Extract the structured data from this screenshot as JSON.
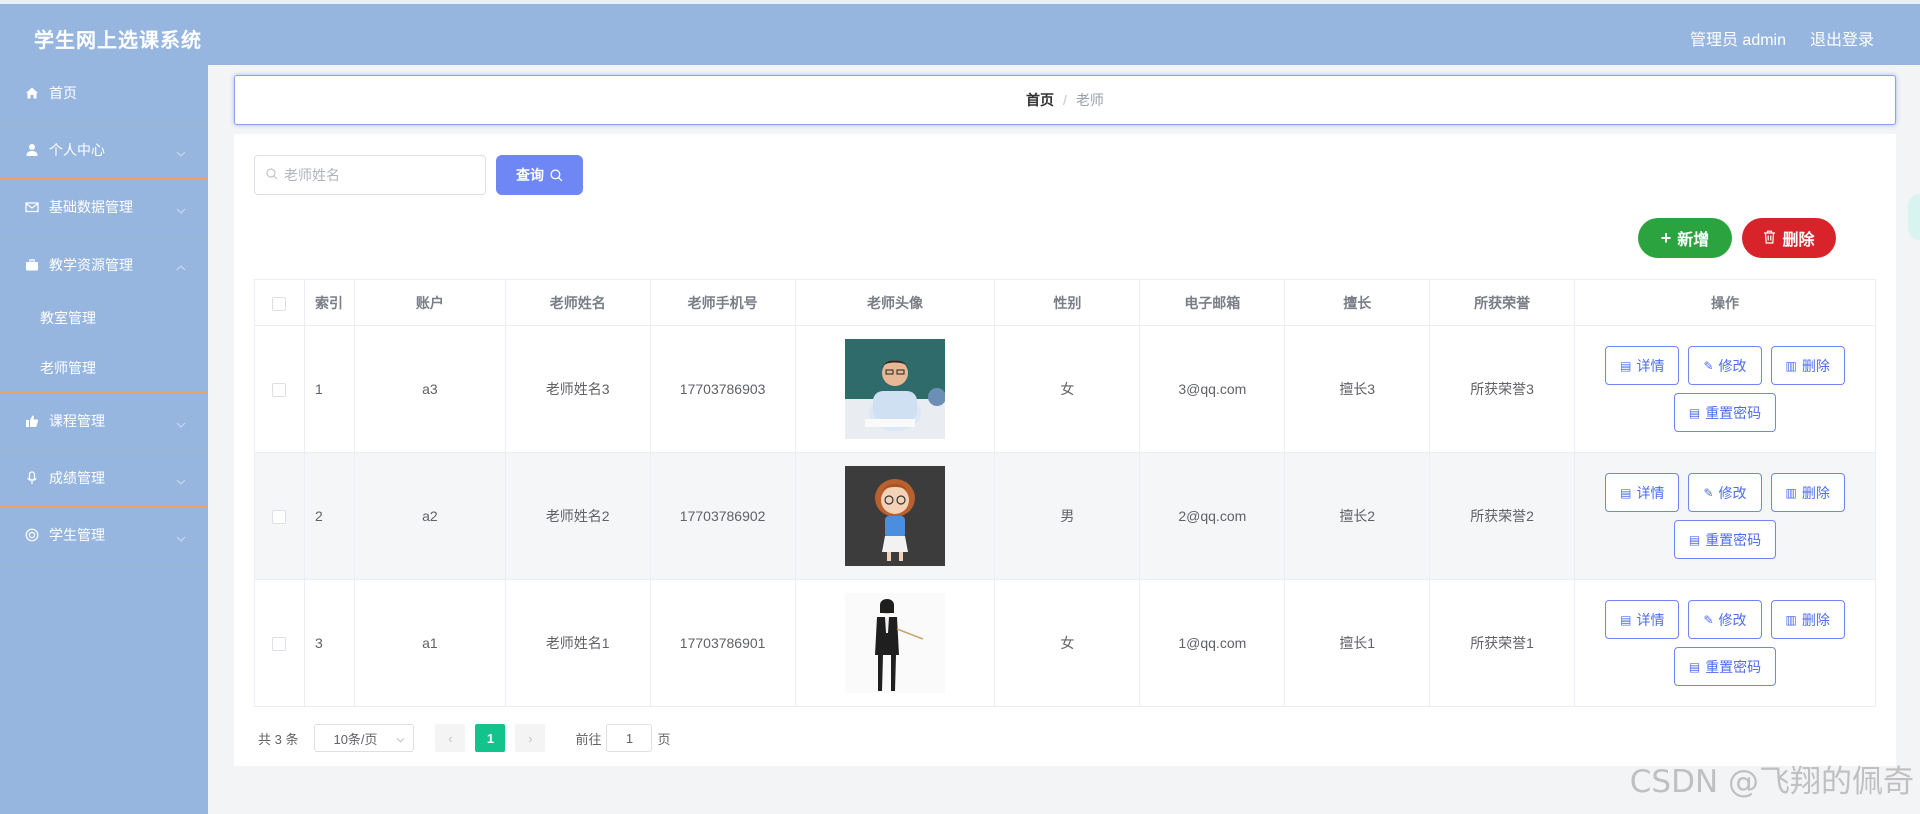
{
  "header": {
    "app_title": "学生网上选课系统",
    "user_label": "管理员 admin",
    "logout_label": "退出登录"
  },
  "sidebar": {
    "items": [
      {
        "label": "首页",
        "icon": "home-icon"
      },
      {
        "label": "个人中心",
        "icon": "user-icon"
      },
      {
        "label": "基础数据管理",
        "icon": "mail-icon"
      },
      {
        "label": "教学资源管理",
        "icon": "briefcase-icon"
      },
      {
        "label": "课程管理",
        "icon": "thumb-icon"
      },
      {
        "label": "成绩管理",
        "icon": "mic-icon"
      },
      {
        "label": "学生管理",
        "icon": "help-icon"
      }
    ],
    "sub_items": [
      {
        "label": "教室管理"
      },
      {
        "label": "老师管理"
      }
    ]
  },
  "breadcrumb": {
    "home": "首页",
    "separator": "/",
    "current": "老师"
  },
  "search": {
    "placeholder": "老师姓名",
    "button_label": "查询"
  },
  "toolbar": {
    "add_label": "新增",
    "delete_label": "删除"
  },
  "table": {
    "columns": [
      "索引",
      "账户",
      "老师姓名",
      "老师手机号",
      "老师头像",
      "性别",
      "电子邮箱",
      "擅长",
      "所获荣誉",
      "操作"
    ],
    "rows": [
      {
        "index": "1",
        "account": "a3",
        "name": "老师姓名3",
        "phone": "17703786903",
        "avatar": "photo-man-at-desk",
        "gender": "女",
        "email": "3@qq.com",
        "specialty": "擅长3",
        "honor": "所获荣誉3"
      },
      {
        "index": "2",
        "account": "a2",
        "name": "老师姓名2",
        "phone": "17703786902",
        "avatar": "cartoon-teacher",
        "gender": "男",
        "email": "2@qq.com",
        "specialty": "擅长2",
        "honor": "所获荣誉2"
      },
      {
        "index": "3",
        "account": "a1",
        "name": "老师姓名1",
        "phone": "17703786901",
        "avatar": "photo-woman-with-pointer",
        "gender": "女",
        "email": "1@qq.com",
        "specialty": "擅长1",
        "honor": "所获荣誉1"
      }
    ],
    "actions": {
      "detail": "详情",
      "edit": "修改",
      "delete": "删除",
      "reset_password": "重置密码"
    }
  },
  "pagination": {
    "total": "共 3 条",
    "page_size": "10条/页",
    "current_page": "1",
    "goto_prefix": "前往",
    "goto_value": "1",
    "goto_suffix": "页"
  },
  "watermark": "CSDN @飞翔的佩奇",
  "colors": {
    "header_bg": "#96b6e0",
    "primary": "#6f86f5",
    "add": "#2ba440",
    "danger": "#d8232a",
    "page_active": "#13c38c"
  }
}
